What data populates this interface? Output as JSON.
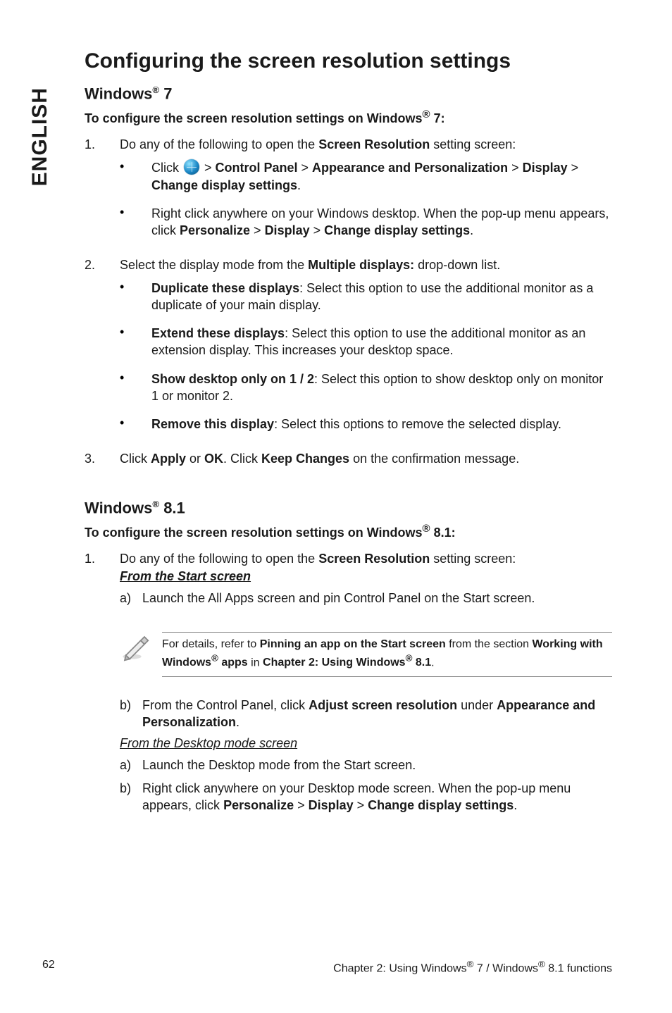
{
  "sidebar": {
    "language": "ENGLISH"
  },
  "title": "Configuring the screen resolution settings",
  "win7": {
    "heading_prefix": "Windows",
    "heading_suffix": " 7",
    "subtitle_prefix": "To configure the screen resolution settings on Windows",
    "subtitle_suffix": " 7:",
    "step1": {
      "num": "1.",
      "text_a": "Do any of the following to open the ",
      "text_b": "Screen Resolution",
      "text_c": " setting screen:",
      "b1_a": "Click ",
      "b1_b": " > ",
      "b1_c": "Control Panel",
      "b1_d": " > ",
      "b1_e": "Appearance and Personalization",
      "b1_f": " > ",
      "b1_g": "Display",
      "b1_h": " > ",
      "b1_i": "Change display settings",
      "b1_j": ".",
      "b2_a": "Right click anywhere on your Windows desktop. When the pop-up menu appears, click ",
      "b2_b": "Personalize",
      "b2_c": " > ",
      "b2_d": "Display",
      "b2_e": " > ",
      "b2_f": "Change display settings",
      "b2_g": "."
    },
    "step2": {
      "num": "2.",
      "text_a": "Select the display mode from the ",
      "text_b": "Multiple displays:",
      "text_c": " drop-down list.",
      "dup_a": "Duplicate these displays",
      "dup_b": ": Select this option to use the additional monitor as a duplicate of your main display.",
      "ext_a": "Extend these displays",
      "ext_b": ": Select this option to use the additional monitor as an extension display. This increases your desktop space.",
      "show_a": "Show desktop only on 1 / 2",
      "show_b": ": Select this option to show desktop only on monitor 1 or monitor 2.",
      "rem_a": "Remove this display",
      "rem_b": ": Select this options to remove the selected display."
    },
    "step3": {
      "num": "3.",
      "a": "Click ",
      "b": "Apply",
      "c": " or ",
      "d": "OK",
      "e": ". Click ",
      "f": "Keep Changes",
      "g": " on the confirmation message."
    }
  },
  "win81": {
    "heading_prefix": "Windows",
    "heading_suffix": " 8.1",
    "subtitle_prefix": "To configure the screen resolution settings on Windows",
    "subtitle_suffix": " 8.1:",
    "step1": {
      "num": "1.",
      "text_a": "Do any of the following to open the ",
      "text_b": "Screen Resolution",
      "text_c": " setting screen:",
      "from_start": "From the Start screen",
      "a_letter": "a)",
      "a_text": "Launch the All Apps screen and pin Control Panel on the Start screen."
    },
    "note": {
      "a": "For details, refer to ",
      "b": "Pinning an app on the Start screen",
      "c": " from the section ",
      "d": "Working with Windows",
      "e": " apps",
      "f": " in ",
      "g": "Chapter 2: Using Windows",
      "h": " 8.1",
      "i": "."
    },
    "b_letter": "b)",
    "b_text_a": "From the Control Panel, click ",
    "b_text_b": "Adjust screen resolution",
    "b_text_c": " under ",
    "b_text_d": "Appearance and Personalization",
    "b_text_e": ".",
    "from_desktop": "From the Desktop mode screen",
    "da_letter": "a)",
    "da_text": "Launch the Desktop mode from the Start screen.",
    "db_letter": "b)",
    "db_text_a": "Right click anywhere on your Desktop mode screen. When the pop-up menu appears, click ",
    "db_text_b": "Personalize",
    "db_text_c": " > ",
    "db_text_d": "Display",
    "db_text_e": " > ",
    "db_text_f": "Change display settings",
    "db_text_g": "."
  },
  "footer": {
    "page": "62",
    "chapter_a": "Chapter 2: Using Windows",
    "chapter_b": " 7 / Windows",
    "chapter_c": " 8.1 functions"
  },
  "reg": "®"
}
